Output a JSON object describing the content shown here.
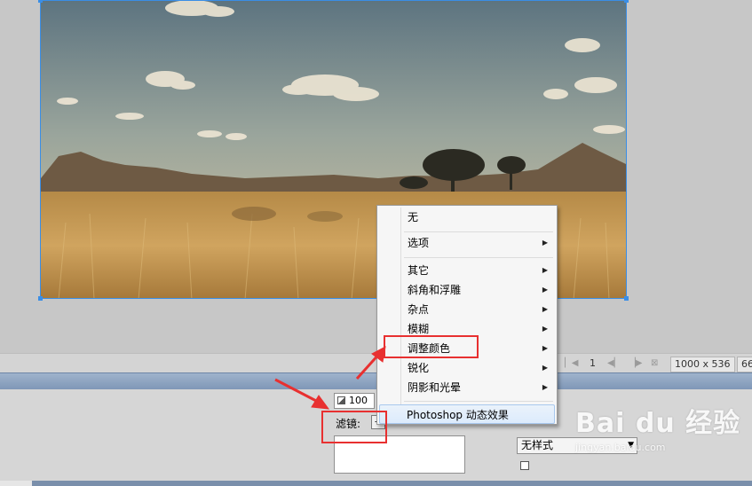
{
  "status_bar": {
    "page": "1",
    "canvas_size": "1000 x 536",
    "zoom": "66"
  },
  "properties": {
    "opacity": "100",
    "filter_label": "滤镜:",
    "add_filter_symbol": "+",
    "style_value": "无样式"
  },
  "context_menu": {
    "items": [
      {
        "label": "无"
      },
      {
        "label": "选项"
      },
      {
        "label": "其它"
      },
      {
        "label": "斜角和浮雕"
      },
      {
        "label": "杂点"
      },
      {
        "label": "模糊"
      },
      {
        "label": "调整颜色"
      },
      {
        "label": "锐化"
      },
      {
        "label": "阴影和光晕"
      },
      {
        "label": "Photoshop 动态效果"
      }
    ],
    "submenu_glyph": "▶"
  },
  "watermark": {
    "brand": "Bai du 经验",
    "url": "jingyan.baidu.com"
  },
  "colors": {
    "selection": "#3a8ee6",
    "annotation_red": "#e83030",
    "panel_bar": "#8ea4c2"
  }
}
